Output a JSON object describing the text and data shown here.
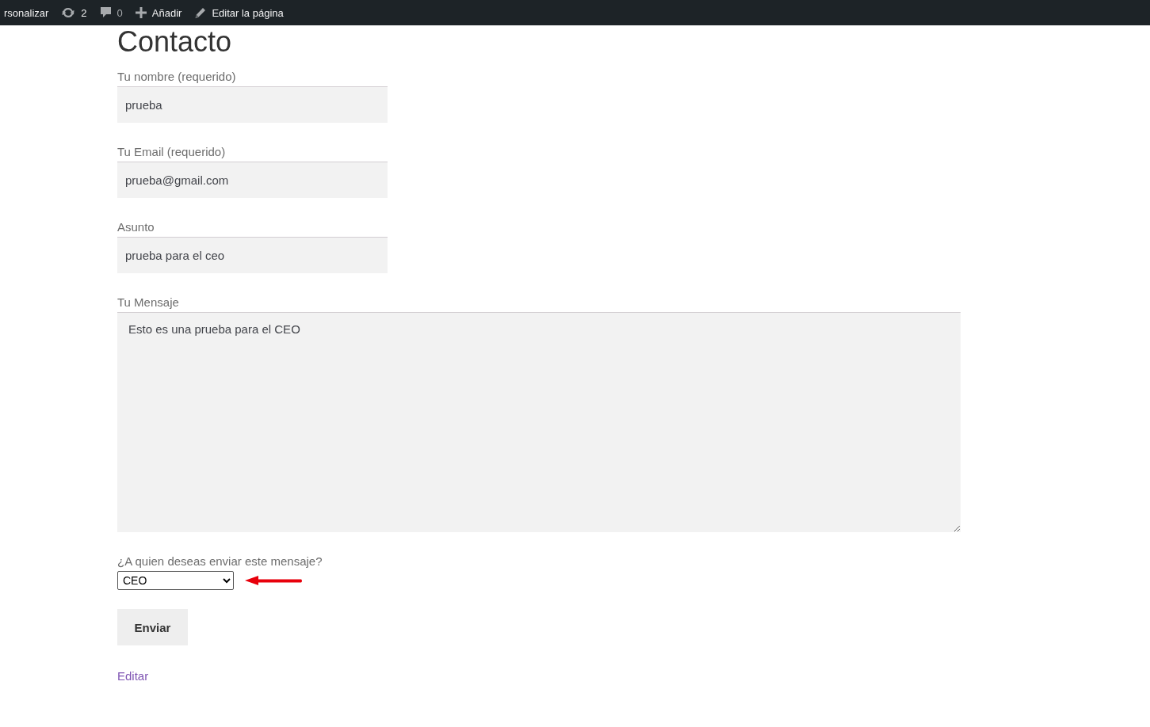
{
  "admin_bar": {
    "items": [
      {
        "kind": "text",
        "label": "rsonalizar"
      },
      {
        "kind": "updates",
        "label": "2"
      },
      {
        "kind": "comments",
        "label": "0"
      },
      {
        "kind": "add",
        "label": "Añadir"
      },
      {
        "kind": "edit",
        "label": "Editar la página"
      }
    ]
  },
  "page": {
    "title": "Contacto",
    "fields": [
      {
        "kind": "input",
        "label": "Tu nombre (requerido)",
        "value": "prueba"
      },
      {
        "kind": "input",
        "label": "Tu Email (requerido)",
        "value": "prueba@gmail.com"
      },
      {
        "kind": "input",
        "label": "Asunto",
        "value": "prueba para el ceo"
      },
      {
        "kind": "textarea",
        "label": "Tu Mensaje",
        "value": "Esto es una prueba para el CEO"
      },
      {
        "kind": "select",
        "label": "¿A quien deseas enviar este mensaje?",
        "value": "CEO"
      }
    ],
    "submit": "Enviar",
    "edit_link": "Editar"
  }
}
